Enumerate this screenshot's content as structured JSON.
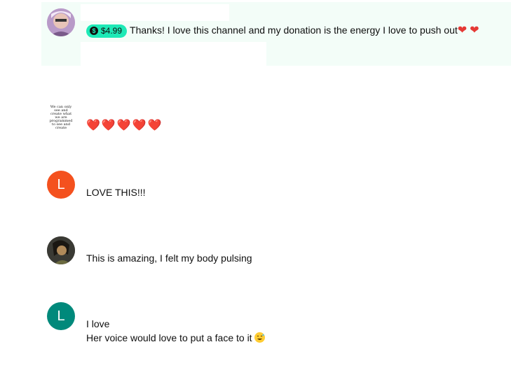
{
  "comments": [
    {
      "type": "paid",
      "amount": "$4.99",
      "text": "Thanks! I love this channel and my donation is the energy I love to push out",
      "avatar": "photo-avatar"
    },
    {
      "type": "regular",
      "avatar_text": "We can only see and create what we are programmed to see and create",
      "text": "❤️❤️❤️❤️❤️"
    },
    {
      "type": "regular",
      "avatar_letter": "L",
      "avatar_color": "#f4511e",
      "text": "LOVE THIS!!!"
    },
    {
      "type": "regular",
      "avatar": "photo-avatar",
      "text": "This is amazing, I felt my body pulsing"
    },
    {
      "type": "regular",
      "avatar_letter": "L",
      "avatar_color": "#00897b",
      "line1": "I love",
      "line2": "Her voice would love to put a face to it"
    }
  ]
}
